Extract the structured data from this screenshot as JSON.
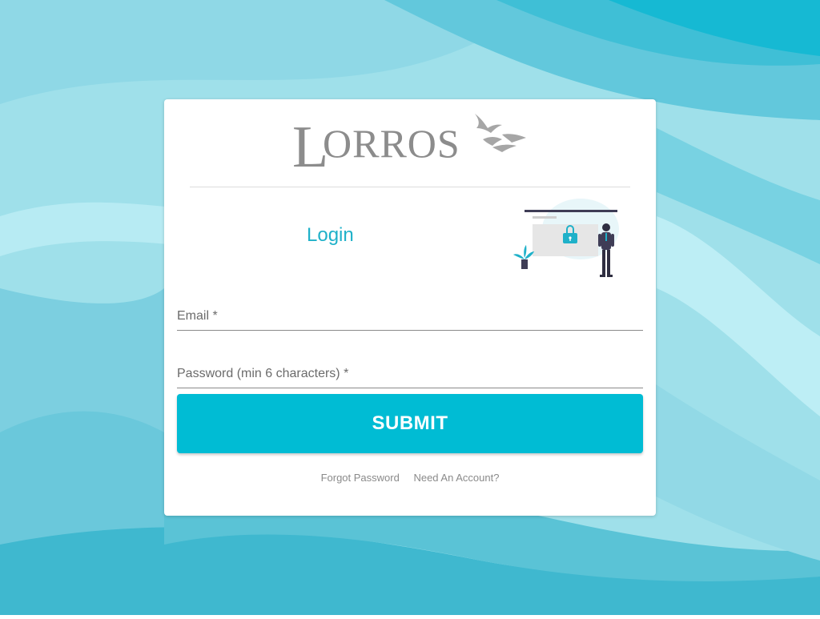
{
  "brand": {
    "logo_text": "LORROS",
    "logo_color": "#8c8c8c"
  },
  "login": {
    "title": "Login"
  },
  "form": {
    "email_label": "Email *",
    "password_label": "Password (min 6 characters) *",
    "submit_label": "SUBMIT"
  },
  "links": {
    "forgot_password": "Forgot Password",
    "need_account": "Need An Account?"
  },
  "colors": {
    "accent": "#00bcd4",
    "title": "#1fb1c9",
    "background_light": "#a6e4ee",
    "background_dark": "#00b8d4"
  },
  "icons": {
    "lock": "lock-icon",
    "person": "person-illustration",
    "plant": "plant-illustration",
    "birds": "birds-icon"
  }
}
